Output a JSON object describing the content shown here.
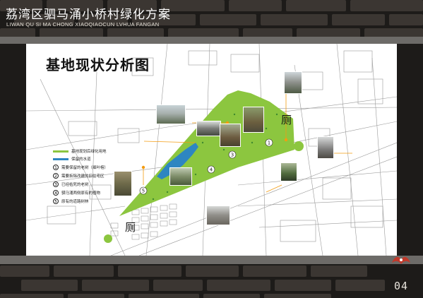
{
  "header": {
    "title": "荔湾区驷马涌小桥村绿化方案",
    "subtitle": "LIWAN QU SI MA CHONG XIAOQIAOCUN LVHUA FANGAN"
  },
  "map": {
    "title": "基地现状分析图",
    "toilet_label": "厕",
    "legend": [
      {
        "kind": "swatch",
        "color": "#8cc63f",
        "label": "基地现划后绿化用地"
      },
      {
        "kind": "swatch",
        "color": "#2e86c1",
        "label": "保留的水道"
      },
      {
        "kind": "number",
        "num": "1",
        "label": "需要保留的老树（细叶榕）"
      },
      {
        "kind": "number",
        "num": "2",
        "label": "需要拆除改建的旧住宅区"
      },
      {
        "kind": "number",
        "num": "3",
        "label": "已经枯死的老树"
      },
      {
        "kind": "number",
        "num": "4",
        "label": "驷马涌两侧原有的植物"
      },
      {
        "kind": "number",
        "num": "5",
        "label": "原有的道路树林"
      }
    ],
    "markers": [
      "1",
      "2",
      "3",
      "4",
      "5"
    ]
  },
  "footer": {
    "page_number": "04"
  },
  "colors": {
    "green_area": "#8cc63f",
    "water": "#2e86c1",
    "callout": "#f39c12",
    "background": "#1d1b19"
  }
}
